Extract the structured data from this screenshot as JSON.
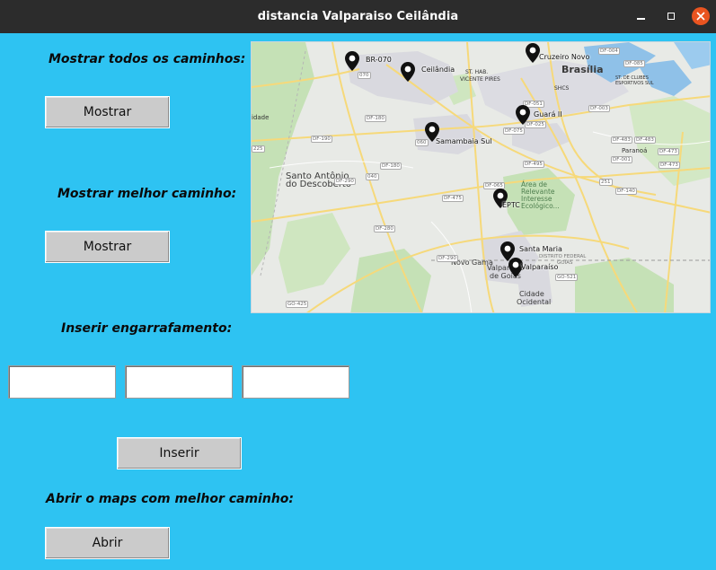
{
  "window": {
    "title": "distancia Valparaiso Ceilândia"
  },
  "sections": {
    "all_paths_label": "Mostrar todos os caminhos:",
    "all_paths_button": "Mostrar",
    "best_path_label": "Mostrar melhor caminho:",
    "best_path_button": "Mostrar",
    "traffic_label": "Inserir engarrafamento:",
    "traffic_inputs": [
      "",
      "",
      ""
    ],
    "insert_button": "Inserir",
    "open_maps_label": "Abrir o maps com melhor caminho:",
    "open_button": "Abrir"
  },
  "map": {
    "pins": [
      {
        "label": "BR-070"
      },
      {
        "label": "Ceilândia"
      },
      {
        "label": "Cruzeiro Novo"
      },
      {
        "label": "Guará II"
      },
      {
        "label": "Samambaia Sul"
      },
      {
        "label": "EPTC"
      },
      {
        "label": "Santa Maria"
      },
      {
        "label": "Valparaíso"
      }
    ],
    "places": {
      "brasilia": "Brasília",
      "st_hab": "ST. HAB.",
      "vicente_pires": "VICENTE PIRES",
      "santo_antonio": "Santo Antônio",
      "do_descoberto": "do Descoberto",
      "area_relevante_1": "Área de",
      "area_relevante_2": "Relevante",
      "area_relevante_3": "Interesse",
      "area_relevante_4": "Ecológico...",
      "novo_gama": "Novo Gama",
      "valparaiso_de_goias_1": "Valparaíso",
      "valparaiso_de_goias_2": "de Goiás",
      "cidade_ocidental_1": "Cidade",
      "cidade_ocidental_2": "Ocidental",
      "paranoa": "Paranoá",
      "setor_clubes_1": "ST. DE CLUBES",
      "setor_clubes_2": "ESPORTIVOS SUL",
      "shcs": "SHCS",
      "cidade_left": "idade",
      "distrito_federal": "DISTRITO FEDERAL",
      "goias": "GOIÁS"
    },
    "roads": [
      "DF-180",
      "DF-190",
      "DF-180",
      "DF-280",
      "DF-290",
      "DF-475",
      "DF-065",
      "DF-483",
      "DF-001",
      "DF-473",
      "DF-140",
      "DF-290",
      "DF-495",
      "DF-003",
      "DF-085",
      "DF-004",
      "DF-075",
      "DF-025",
      "DF-051",
      "GO-521",
      "GO-425",
      "225",
      "060",
      "040",
      "251",
      "070",
      "DF-483",
      "DF-473"
    ],
    "colors": {
      "land": "#e8eae6",
      "green": "#c5e1b6",
      "urban": "#d9d9df",
      "water": "#8fc1e8",
      "road": "#f6d97a",
      "pin": "#111111"
    }
  }
}
